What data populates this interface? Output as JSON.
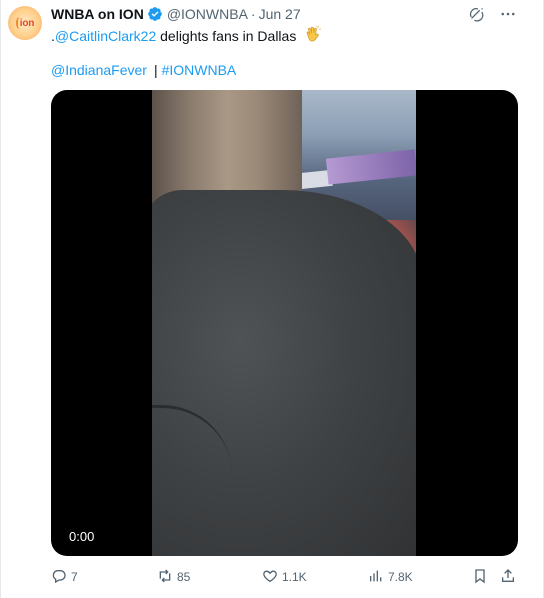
{
  "post": {
    "author": {
      "display_name": "WNBA on ION",
      "handle": "@IONWNBA",
      "verified": true,
      "avatar_text": "ion"
    },
    "separator": "·",
    "date": "Jun 27",
    "text_prefix": ".",
    "mention": "@CaitlinClark22",
    "text_body": " delights fans in Dallas",
    "emoji": "clapping-hands",
    "tags": {
      "mention": "@IndianaFever",
      "separator": "|",
      "hashtag": "#IONWNBA"
    },
    "video": {
      "timestamp": "0:00"
    },
    "metrics": {
      "replies": "7",
      "reposts": "85",
      "likes": "1.1K",
      "views": "7.8K"
    }
  },
  "colors": {
    "link": "#1d9bf0",
    "muted": "#536471",
    "text": "#0f1419",
    "verified": "#1d9bf0"
  }
}
